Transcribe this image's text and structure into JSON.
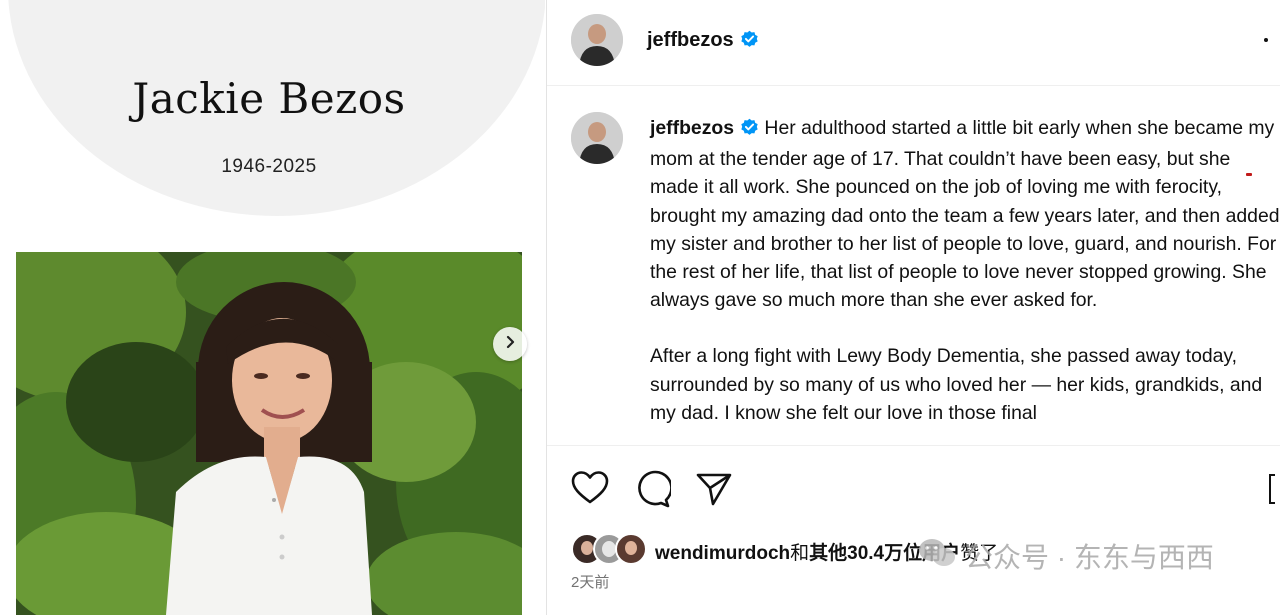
{
  "memorial": {
    "name": "Jackie Bezos",
    "years": "1946-2025"
  },
  "post": {
    "author": "jeffbezos",
    "caption": {
      "username": "jeffbezos",
      "p1_before": " Her adulthood started a little bit early when she became ",
      "p1_highlight": "my mom at the tender age of 17",
      "p1_after": ". That couldn’t have been easy, but she made it all work. She pounced on the job of loving me with ferocity, brought my amazing dad onto the team a few years later, and then added my sister and brother to her list of people to love, guard, and nourish. For the rest of her life, that list of people to love never stopped growing. She always gave so much more than she ever asked for.",
      "p2": "After a long fight with Lewy Body Dementia, she passed away today, surrounded by so many of us who loved her — her kids, grandkids, and my dad. I know she felt our love in those final"
    },
    "likes": {
      "user": "wendimurdoch",
      "connector": "和",
      "bold_part": "其他30.4万位用户",
      "suffix": "赞了"
    },
    "timestamp": "2天前"
  },
  "watermark": {
    "text": "公众号 · 东东与西西"
  },
  "icons": {
    "verified": "verified-badge-icon",
    "like": "heart-icon",
    "comment": "comment-icon",
    "share": "send-icon",
    "save": "bookmark-icon",
    "next": "chevron-right-icon"
  },
  "colors": {
    "verified": "#0095f6",
    "underline": "#c11a1a",
    "muted": "#737373"
  }
}
